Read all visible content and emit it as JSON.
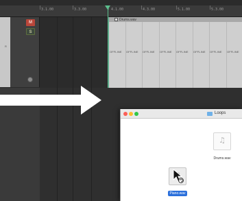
{
  "ruler": {
    "labels": [
      "3.1.00",
      "3.3.00",
      "4.1.00",
      "4.3.00",
      "5.1.00",
      "5.3.00"
    ]
  },
  "track": {
    "mute_label": "M",
    "solo_label": "S",
    "header_text": "R"
  },
  "region": {
    "title": "Drums.wav",
    "status": "OFFLINE",
    "status_count": 9
  },
  "finder": {
    "title": "Loops",
    "files": [
      {
        "name": "Drums.wav",
        "selected": false,
        "icon": "audio-file-icon"
      },
      {
        "name": "Piano.wav",
        "selected": true,
        "icon": "audio-file-icon"
      }
    ]
  },
  "colors": {
    "playhead": "#5cbf8d",
    "mute": "#b9463a",
    "selection": "#2a6fdb",
    "traffic_close": "#fc5f57",
    "traffic_min": "#fdbc2e",
    "traffic_zoom": "#33c748"
  },
  "icons": {
    "drag_arrow": "right-arrow-icon",
    "cursor": "drag-copy-cursor-icon"
  }
}
